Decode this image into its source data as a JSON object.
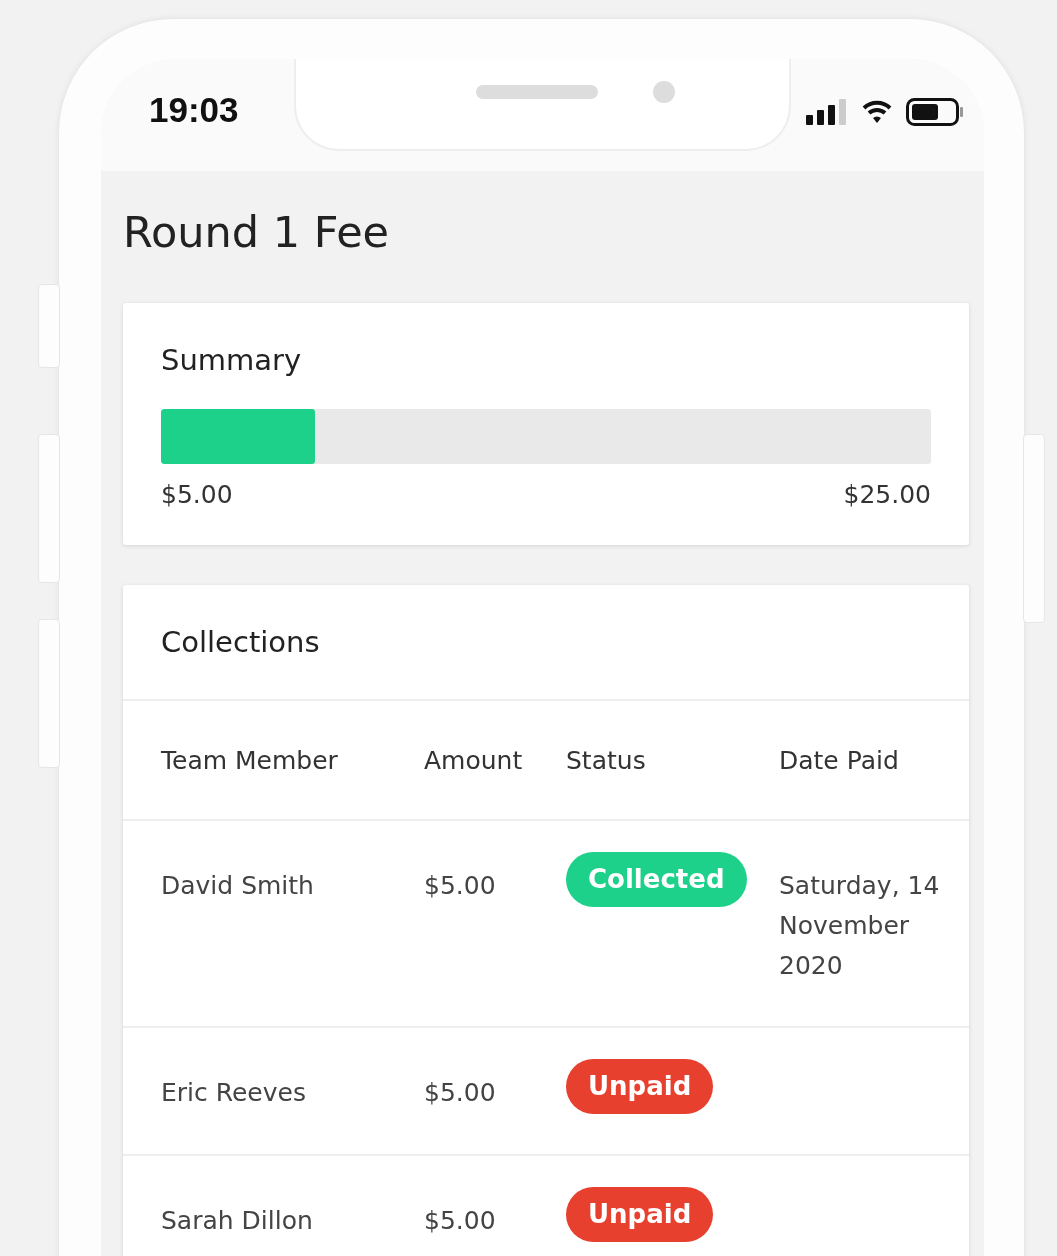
{
  "status_bar": {
    "time": "19:03"
  },
  "title": "Round 1 Fee",
  "summary": {
    "title": "Summary",
    "level": 0.2,
    "collected": "$5.00",
    "target": "$25.00"
  },
  "collections": {
    "title": "Collections",
    "columns": [
      "Team Member",
      "Amount",
      "Status",
      "Date Paid"
    ],
    "rows": [
      {
        "member": "David Smith",
        "amount": "$5.00",
        "status": {
          "label": "Collected",
          "kind": "collected"
        },
        "date_paid": "Saturday, 14 November 2020"
      },
      {
        "member": "Eric Reeves",
        "amount": "$5.00",
        "status": {
          "label": "Unpaid",
          "kind": "unpaid"
        }
      },
      {
        "member": "Sarah Dillon",
        "amount": "$5.00",
        "status": {
          "label": "Unpaid",
          "kind": "unpaid"
        }
      }
    ]
  }
}
